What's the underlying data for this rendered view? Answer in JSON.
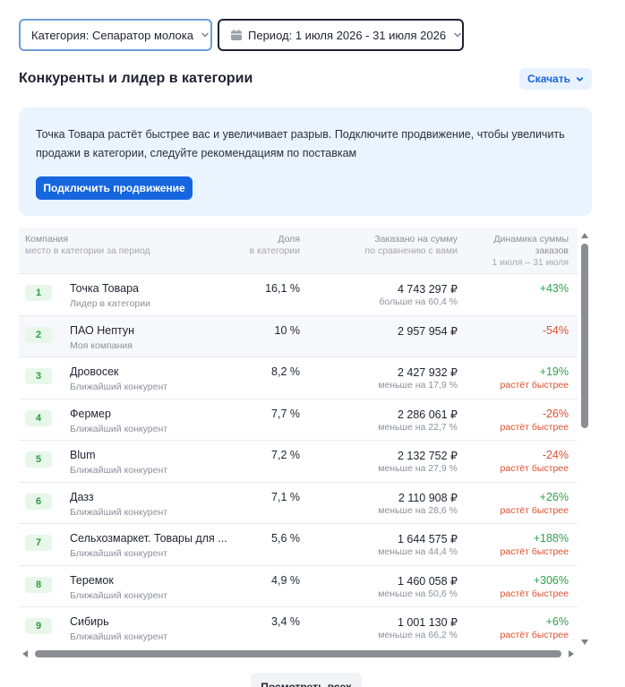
{
  "filters": {
    "category": "Категория: Сепаратор молока",
    "period": "Период: 1 июля 2026 - 31 июля 2026"
  },
  "section": {
    "title": "Конкуренты и лидер в категории",
    "download_label": "Скачать"
  },
  "banner": {
    "message": "Точка Товара растёт быстрее вас и увеличивает разрыв. Подключите продвижение, чтобы увеличить продажи в категории, следуйте рекомендациям по поставкам",
    "button_label": "Подключить продвижение"
  },
  "table": {
    "headers": {
      "company": "Компания",
      "company_sub": "место в категории за период",
      "share": "Доля",
      "share_sub": "в категории",
      "sum": "Заказано на сумму",
      "sum_sub": "по сравнению с вами",
      "dynamics": "Динамика суммы заказов",
      "dynamics_sub": "1 июля – 31 июля"
    },
    "rows": [
      {
        "rank": "1",
        "name": "Точка Товара",
        "role": "Лидер в категории",
        "share": "16,1 %",
        "sum": "4 743 297 ₽",
        "compare": "больше на 60,4 %",
        "dynamics": "+43%",
        "trend": "up",
        "note": ""
      },
      {
        "rank": "2",
        "name": "ПАО Нептун",
        "role": "Моя компания",
        "share": "10 %",
        "sum": "2 957 954 ₽",
        "compare": "",
        "dynamics": "-54%",
        "trend": "down",
        "note": ""
      },
      {
        "rank": "3",
        "name": "Дровосек",
        "role": "Ближайший конкурент",
        "share": "8,2 %",
        "sum": "2 427 932 ₽",
        "compare": "меньше на 17,9 %",
        "dynamics": "+19%",
        "trend": "up",
        "note": "растёт быстрее"
      },
      {
        "rank": "4",
        "name": "Фермер",
        "role": "Ближайший конкурент",
        "share": "7,7 %",
        "sum": "2 286 061 ₽",
        "compare": "меньше на 22,7 %",
        "dynamics": "-26%",
        "trend": "down",
        "note": "растёт быстрее"
      },
      {
        "rank": "5",
        "name": "Blum",
        "role": "Ближайший конкурент",
        "share": "7,2 %",
        "sum": "2 132 752 ₽",
        "compare": "меньше на 27,9 %",
        "dynamics": "-24%",
        "trend": "down",
        "note": "растёт быстрее"
      },
      {
        "rank": "6",
        "name": "Дазз",
        "role": "Ближайший конкурент",
        "share": "7,1 %",
        "sum": "2 110 908 ₽",
        "compare": "меньше на 28,6 %",
        "dynamics": "+26%",
        "trend": "up",
        "note": "растёт быстрее"
      },
      {
        "rank": "7",
        "name": "Сельхозмаркет. Товары для ...",
        "role": "Ближайший конкурент",
        "share": "5,6 %",
        "sum": "1 644 575 ₽",
        "compare": "меньше на 44,4 %",
        "dynamics": "+188%",
        "trend": "up",
        "note": "растёт быстрее"
      },
      {
        "rank": "8",
        "name": "Теремок",
        "role": "Ближайший конкурент",
        "share": "4,9 %",
        "sum": "1 460 058 ₽",
        "compare": "меньше на 50,6 %",
        "dynamics": "+306%",
        "trend": "up",
        "note": "растёт быстрее"
      },
      {
        "rank": "9",
        "name": "Сибирь",
        "role": "Ближайший конкурент",
        "share": "3,4 %",
        "sum": "1 001 130 ₽",
        "compare": "меньше на 66,2 %",
        "dynamics": "+6%",
        "trend": "up",
        "note": "растёт быстрее"
      }
    ]
  },
  "show_all_label": "Посмотреть всех",
  "colors": {
    "accent": "#1666e0",
    "positive": "#2ea24a",
    "negative": "#e0502f",
    "banner_bg": "#e9f4fe"
  }
}
